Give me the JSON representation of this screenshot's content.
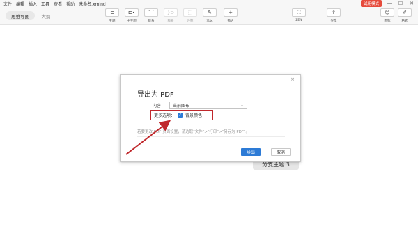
{
  "menubar": {
    "items": [
      "文件",
      "编辑",
      "插入",
      "工具",
      "查看",
      "帮助"
    ],
    "filename": "未命名.xmind"
  },
  "topright": {
    "trial_badge": "试用模式",
    "controls": [
      "—",
      "☐",
      "✕"
    ]
  },
  "tabs": {
    "active": "思维导图",
    "inactive": "大纲"
  },
  "toolbar": {
    "tools": [
      {
        "label": "主题",
        "icon": "topic-icon",
        "glyph": "⊏",
        "enabled": true
      },
      {
        "label": "子主题",
        "icon": "subtopic-icon",
        "glyph": "⊏∙",
        "enabled": true
      },
      {
        "label": "联系",
        "icon": "relationship-icon",
        "glyph": "⌒",
        "enabled": true
      },
      {
        "label": "概要",
        "icon": "summary-icon",
        "glyph": "}⊃",
        "enabled": false
      },
      {
        "label": "外框",
        "icon": "boundary-icon",
        "glyph": "⬚",
        "enabled": false
      },
      {
        "label": "笔记",
        "icon": "note-icon",
        "glyph": "✎",
        "enabled": true
      },
      {
        "label": "插入",
        "icon": "insert-icon",
        "glyph": "+",
        "enabled": true
      },
      {
        "label": "ZEN",
        "icon": "zen-icon",
        "glyph": "⛶",
        "enabled": true
      },
      {
        "label": "分享",
        "icon": "share-icon",
        "glyph": "⇪",
        "enabled": true
      },
      {
        "label": "图标",
        "icon": "marker-icon",
        "glyph": "☺",
        "enabled": true
      },
      {
        "label": "格式",
        "icon": "format-icon",
        "glyph": "✐",
        "enabled": true
      }
    ]
  },
  "canvas": {
    "topic_label": "分支主题 3"
  },
  "dialog": {
    "close": "×",
    "title": "导出为 PDF",
    "content_label": "内容：",
    "content_value": "当前图布",
    "more_label": "更多选项：",
    "checkbox_label": "背景颜色",
    "checkbox_checked": true,
    "hint": "若要更改 PDF 页面设置，请选取\"文件\">\"打印\">\"另存为 PDF\"。",
    "export_button": "导出",
    "cancel_button": "取消"
  },
  "colors": {
    "accent": "#2d7bd6",
    "highlight_border": "#c0282c",
    "arrow": "#c0282c",
    "trial_badge": "#e64b3c"
  }
}
